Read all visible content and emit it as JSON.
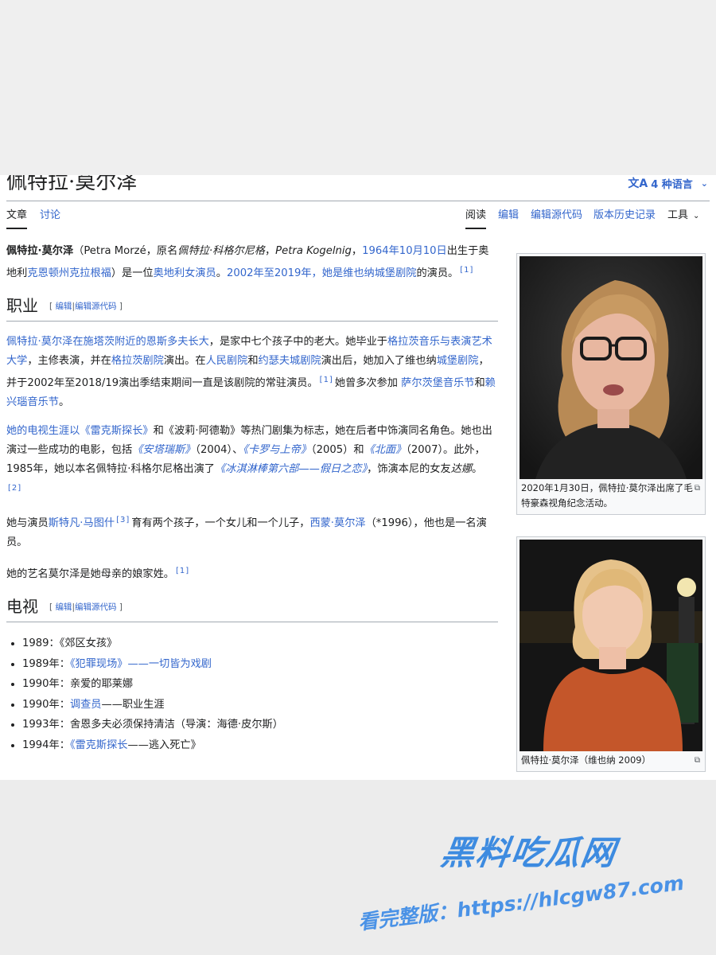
{
  "page": {
    "title": "佩特拉·莫尔泽",
    "languages_label": "4 种语言"
  },
  "tabs": {
    "left": [
      "文章",
      "讨论"
    ],
    "right": [
      "阅读",
      "编辑",
      "编辑源代码",
      "版本历史记录"
    ],
    "tools": "工具"
  },
  "lead": {
    "bold_name": "佩特拉·莫尔泽",
    "t1": "（Petra Morzé，原名",
    "italic_birth_name": "佩特拉·科格尔尼格",
    "t2": "，",
    "italic_latin_name": "Petra Kogelnig",
    "t3": "，",
    "link_date": "1964年10月10日",
    "t4": "出生于奥地利",
    "link_klagenfurt": "克恩顿州克拉根福",
    "t5": "）是一位",
    "link_actress": "奥地利女演员",
    "t6": "。",
    "link_burg": "2002年至2019年，她是维也纳城堡剧院",
    "t7": "的演员。",
    "ref": "[1]"
  },
  "sections": {
    "career_heading": "职业",
    "tv_heading": "电视",
    "edit_label": "编辑",
    "editsrc_label": "编辑源代码"
  },
  "career": {
    "p1": {
      "link_intro": "佩特拉·莫尔泽在施塔茨附近的恩斯多夫长大",
      "t1": "，是家中七个孩子中的老大。她毕业于",
      "link_graz_uni": "格拉茨音乐与表演艺术大学",
      "t2": "，主修表演，并在",
      "link_graz_theater": "格拉茨剧院",
      "t3": "演出。在",
      "link_volkstheater": "人民剧院",
      "t4": "和",
      "link_josefstadt": "约瑟夫城剧院",
      "t5": "演出后，她加入了维也纳",
      "link_burgtheater": "城堡剧院",
      "t6": "，并于2002年至2018/19演出季结束期间一直是该剧院的常驻演员。",
      "ref": "[1]",
      "t7": "她曾多次参加 ",
      "link_salzburg": "萨尔茨堡音乐节",
      "t8": "和",
      "link_reichenau": "赖兴瑙音乐节",
      "t9": "。"
    },
    "p2": {
      "link_tv_career": "她的电视生涯以",
      "link_rex": "《雷克斯探长》",
      "t1": "和《波莉·阿德勒》等热门剧集为标志，她在后者中饰演同名角色。她也出演过一些成功的电影，包括",
      "film1": "《安塔瑞斯》",
      "t2": "（2004）、",
      "film2": "《卡罗与上帝》",
      "t3": "（2005）和",
      "film3": "《北面》",
      "t4": "（2007）。此外，1985年，她以本名佩特拉·科格尔尼格出演了",
      "film4": "《冰淇淋棒第六部——假日之恋》",
      "t5": "，饰演本尼的女友",
      "italic_role": "达娜",
      "t6": "。",
      "ref": "[2]"
    },
    "p3": {
      "t1": "她与演员",
      "link_partner": "斯特凡·马图什",
      "ref": "[3]",
      "t2": "育有两个孩子，一个女儿和一个儿子，",
      "link_son": "西蒙·莫尔泽",
      "t3": "（*1996），他也是一名演员。"
    },
    "p4": {
      "t1": "她的艺名莫尔泽是她母亲的娘家姓。",
      "ref": "[1]"
    }
  },
  "tv_list": [
    {
      "year": "1989：",
      "pre": "《郊区女孩》",
      "link": "",
      "post": ""
    },
    {
      "year": "1989年：",
      "pre": "",
      "link": "《犯罪现场》——一切皆为戏剧",
      "post": ""
    },
    {
      "year": "1990年：",
      "pre": "亲爱的耶莱娜",
      "link": "",
      "post": ""
    },
    {
      "year": "1990年：",
      "pre": "",
      "link": "调查员",
      "post": "——职业生涯"
    },
    {
      "year": "1993年：",
      "pre": "舍恩多夫必须保持清洁（导演：海德·皮尔斯）",
      "link": "",
      "post": ""
    },
    {
      "year": "1994年：",
      "pre": "",
      "link": "《雷克斯探长",
      "post": "——逃入死亡》"
    }
  ],
  "infobox": {
    "caption1": "2020年1月30日，佩特拉·莫尔泽出席了毛特豪森视角纪念活动。",
    "caption2": "佩特拉·莫尔泽（维也纳 2009）"
  },
  "watermark": {
    "line1": "黑料吃瓜网",
    "line2": "看完整版：https://hlcgw87.com"
  },
  "colors": {
    "link": "#3366cc",
    "text": "#202122",
    "watermark": "#3d8be0"
  },
  "icons": [
    "translate-icon",
    "chevron-down-icon",
    "magnify-icon"
  ]
}
